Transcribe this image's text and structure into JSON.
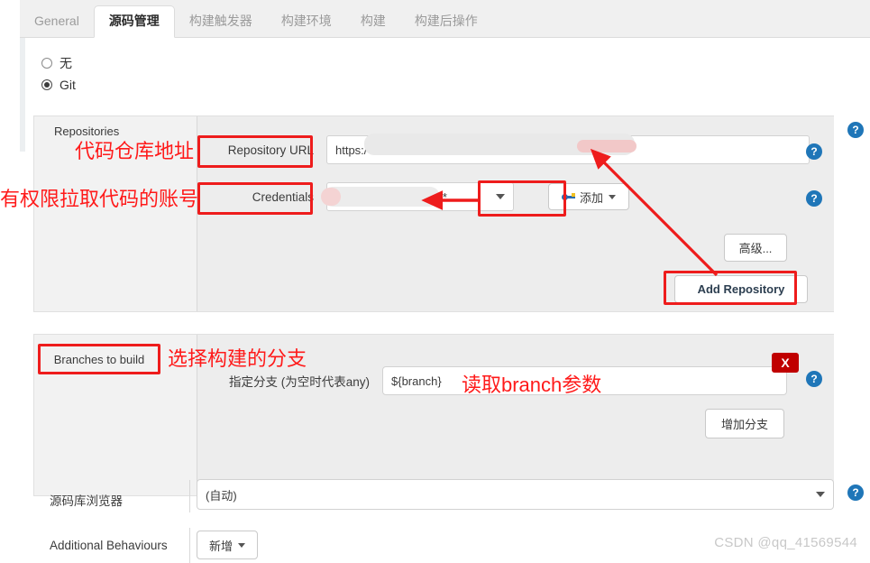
{
  "tabs": [
    {
      "label": "General",
      "active": false
    },
    {
      "label": "源码管理",
      "active": true
    },
    {
      "label": "构建触发器",
      "active": false
    },
    {
      "label": "构建环境",
      "active": false
    },
    {
      "label": "构建",
      "active": false
    },
    {
      "label": "构建后操作",
      "active": false
    }
  ],
  "scm": {
    "none_label": "无",
    "git_label": "Git",
    "selected": "Git"
  },
  "repositories": {
    "section_label": "Repositories",
    "url_field_label": "Repository URL",
    "url_value": "https:/",
    "url_placeholder": "",
    "credentials_label": "Credentials",
    "credentials_value": "/******",
    "add_credentials_button": "添加",
    "advanced_button": "高级...",
    "add_repository_button": "Add Repository"
  },
  "branches": {
    "section_label": "Branches to build",
    "specifier_label": "指定分支 (为空时代表any)",
    "branch_value": "${branch}",
    "add_branch_button": "增加分支",
    "delete_button": "X"
  },
  "repo_browser": {
    "label": "源码库浏览器",
    "value": "(自动)",
    "options": [
      "(自动)"
    ]
  },
  "additional_behaviours": {
    "label": "Additional Behaviours",
    "add_button": "新增"
  },
  "help": {
    "glyph": "?"
  },
  "annotations": [
    {
      "id": "repo-url-note",
      "text": "代码仓库地址"
    },
    {
      "id": "credentials-note",
      "text": "有权限拉取代码的账号"
    },
    {
      "id": "branches-note",
      "text": "选择构建的分支"
    },
    {
      "id": "branch-param-note",
      "text": "读取branch参数"
    }
  ],
  "watermark": "CSDN @qq_41569544",
  "colors": {
    "annotation_red": "#ff1a1a",
    "box_red": "#ee1c1c",
    "delete_red": "#c00000",
    "help_blue": "#1f76b8",
    "panel_grey": "#f2f2f2",
    "inner_grey": "#ededed"
  }
}
